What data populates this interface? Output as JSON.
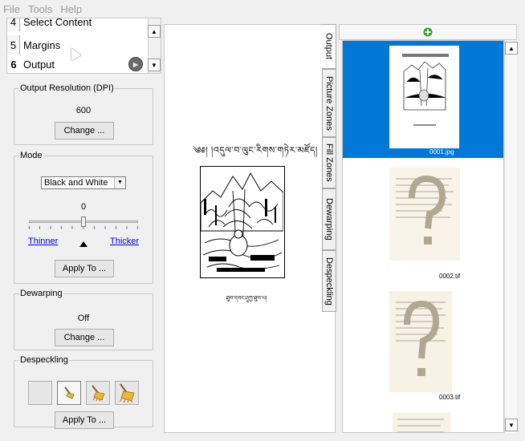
{
  "menu": [
    "File",
    "Tools",
    "Help"
  ],
  "stages": [
    {
      "num": "4",
      "label": "Select Content"
    },
    {
      "num": "5",
      "label": "Margins"
    },
    {
      "num": "6",
      "label": "Output"
    }
  ],
  "output_resolution": {
    "title": "Output Resolution (DPI)",
    "value": "600",
    "change_label": "Change ..."
  },
  "mode": {
    "title": "Mode",
    "selected": "Black and White",
    "threshold": "0",
    "slider_fraction": 0.5,
    "thinner": "Thinner",
    "thicker": "Thicker",
    "apply_label": "Apply To ..."
  },
  "dewarping": {
    "title": "Dewarping",
    "value": "Off",
    "change_label": "Change ..."
  },
  "despeckling": {
    "title": "Despeckling",
    "apply_label": "Apply To ..."
  },
  "tabs": [
    "Output",
    "Picture Zones",
    "Fill Zones",
    "Dewarping",
    "Despeckling"
  ],
  "preview": {
    "title": "༄༅། །འདུལ་བ་ལུང་རིགས་གཏེར་མཛོད།",
    "caption": "ཐུབ་དབང་ཤཱཀྱ་ཐུབ་པ།"
  },
  "thumbnails": [
    {
      "label": "0001.jpg"
    },
    {
      "label": "0002.tif"
    },
    {
      "label": "0003.tif"
    }
  ],
  "colors": {
    "selection": "#0078d7",
    "link": "#0000ee",
    "add_icon": "#2f9e2f"
  }
}
